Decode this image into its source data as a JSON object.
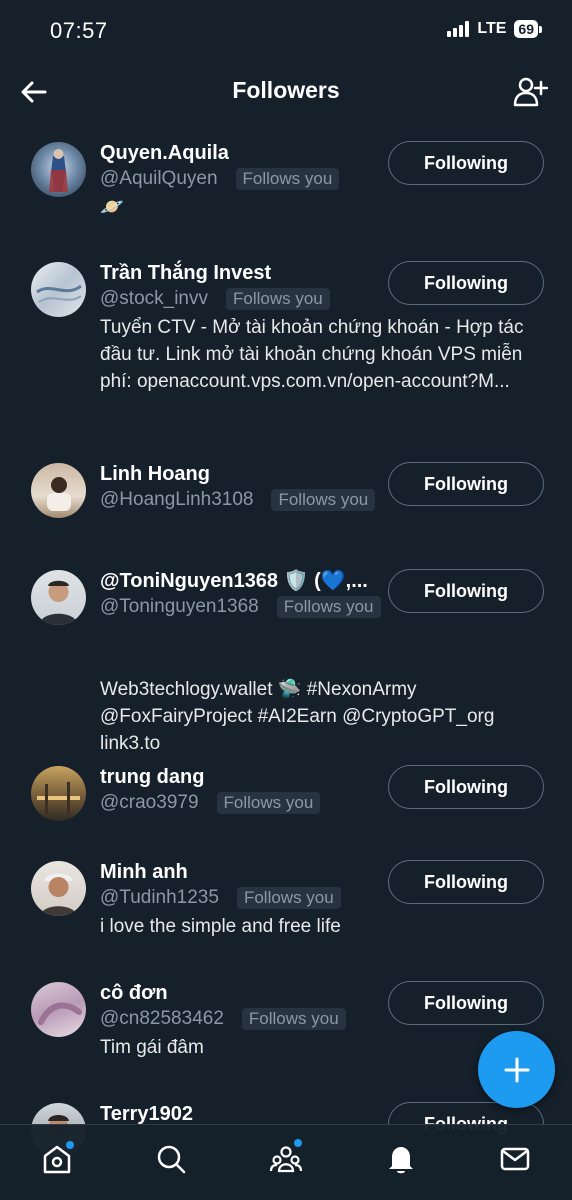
{
  "status_bar": {
    "time": "07:57",
    "network": "LTE",
    "battery": "69"
  },
  "header": {
    "title": "Followers"
  },
  "followers": [
    {
      "name": "Quyen.Aquila",
      "handle": "@AquilQuyen",
      "badge": "Follows you",
      "bio": "🪐",
      "button": "Following"
    },
    {
      "name": "Trần Thắng Invest",
      "handle": "@stock_invv",
      "badge": "Follows you",
      "bio": "Tuyển CTV - Mở tài khoản chứng khoán - Hợp tác đầu tư. Link mở tài khoản chứng khoán VPS miễn phí: openaccount.vps.com.vn/open-account?M...",
      "button": "Following"
    },
    {
      "name": "Linh Hoang",
      "handle": "@HoangLinh3108",
      "badge": "Follows you",
      "bio": "",
      "button": "Following"
    },
    {
      "name": "@ToniNguyen1368 🛡️ (💙,...",
      "handle": "@Toninguyen1368",
      "badge": "Follows you",
      "bio": "Web3techlogy.wallet 🛸 #NexonArmy @FoxFairyProject #AI2Earn @CryptoGPT_org link3.to",
      "button": "Following"
    },
    {
      "name": "trung dang",
      "handle": "@crao3979",
      "badge": "Follows you",
      "bio": "",
      "button": "Following"
    },
    {
      "name": "Minh anh",
      "handle": "@Tudinh1235",
      "badge": "Follows you",
      "bio": "i love the simple and free life",
      "button": "Following"
    },
    {
      "name": "cô đơn",
      "handle": "@cn82583462",
      "badge": "Follows you",
      "bio": "Tim gái đâm",
      "button": "Following"
    },
    {
      "name": "Terry1902",
      "handle": "",
      "badge": "",
      "bio": "",
      "button": "Following"
    }
  ],
  "icons": {
    "back": "arrow-left-icon",
    "add_user": "add-user-icon",
    "fab": "plus-icon",
    "nav": [
      "home-icon",
      "search-icon",
      "communities-icon",
      "notifications-icon",
      "messages-icon"
    ]
  },
  "colors": {
    "background": "#15202b",
    "accent": "#1d9bf0",
    "muted": "#8b98a5",
    "badge_bg": "#273340"
  }
}
